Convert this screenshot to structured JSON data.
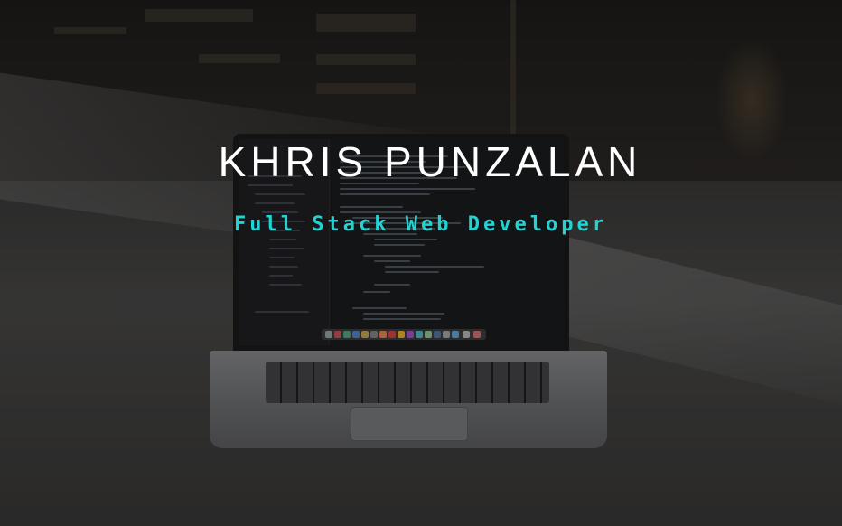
{
  "hero": {
    "title": "KHRIS PUNZALAN",
    "subtitle": "Full Stack Web Developer"
  },
  "colors": {
    "title": "#ffffff",
    "subtitle_accent": "#22d3d3",
    "overlay": "#000000"
  },
  "background": {
    "image_subject": "laptop-with-code-editor-photo"
  }
}
